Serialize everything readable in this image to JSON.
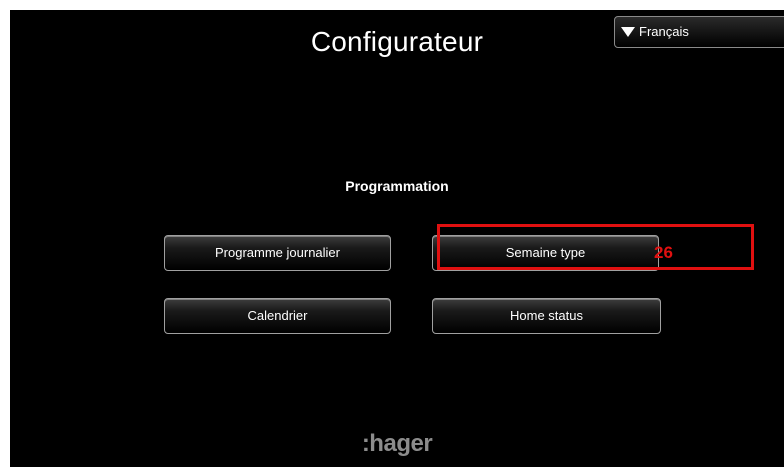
{
  "header": {
    "title": "Configurateur",
    "language": {
      "selected": "Français",
      "icon": "triangle-down-icon"
    }
  },
  "main": {
    "section_title": "Programmation",
    "buttons": [
      {
        "label": "Programme journalier"
      },
      {
        "label": "Semaine type"
      },
      {
        "label": "Calendrier"
      },
      {
        "label": "Home status"
      }
    ]
  },
  "footer": {
    "logo_text": ":hager"
  },
  "annotation": {
    "label": "26",
    "color": "#e01010"
  },
  "colors": {
    "background": "#000000",
    "text": "#ffffff",
    "logo": "#8c8c8c"
  }
}
